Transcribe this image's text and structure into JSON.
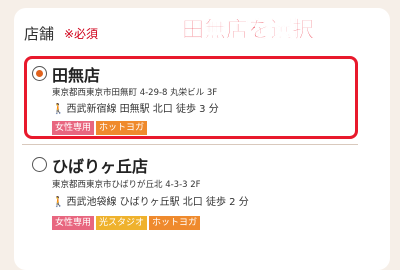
{
  "section": {
    "label": "店舗",
    "required": "※必須"
  },
  "callout": "田無店を選択",
  "stores": [
    {
      "name": "田無店",
      "address": "東京都西東京市田無町 4-29-8 丸栄ビル 3F",
      "access": "西武新宿線 田無駅 北口 徒歩 3 分",
      "selected": true,
      "tags": [
        {
          "label": "女性専用",
          "color": "#e8667f"
        },
        {
          "label": "ホットヨガ",
          "color": "#ef8a2d"
        }
      ]
    },
    {
      "name": "ひばりヶ丘店",
      "address": "東京都西東京市ひばりが丘北 4-3-3 2F",
      "access": "西武池袋線 ひばりヶ丘駅 北口 徒歩 2 分",
      "selected": false,
      "tags": [
        {
          "label": "女性専用",
          "color": "#e8667f"
        },
        {
          "label": "光スタジオ",
          "color": "#efb22d"
        },
        {
          "label": "ホットヨガ",
          "color": "#ef8a2d"
        }
      ]
    }
  ]
}
